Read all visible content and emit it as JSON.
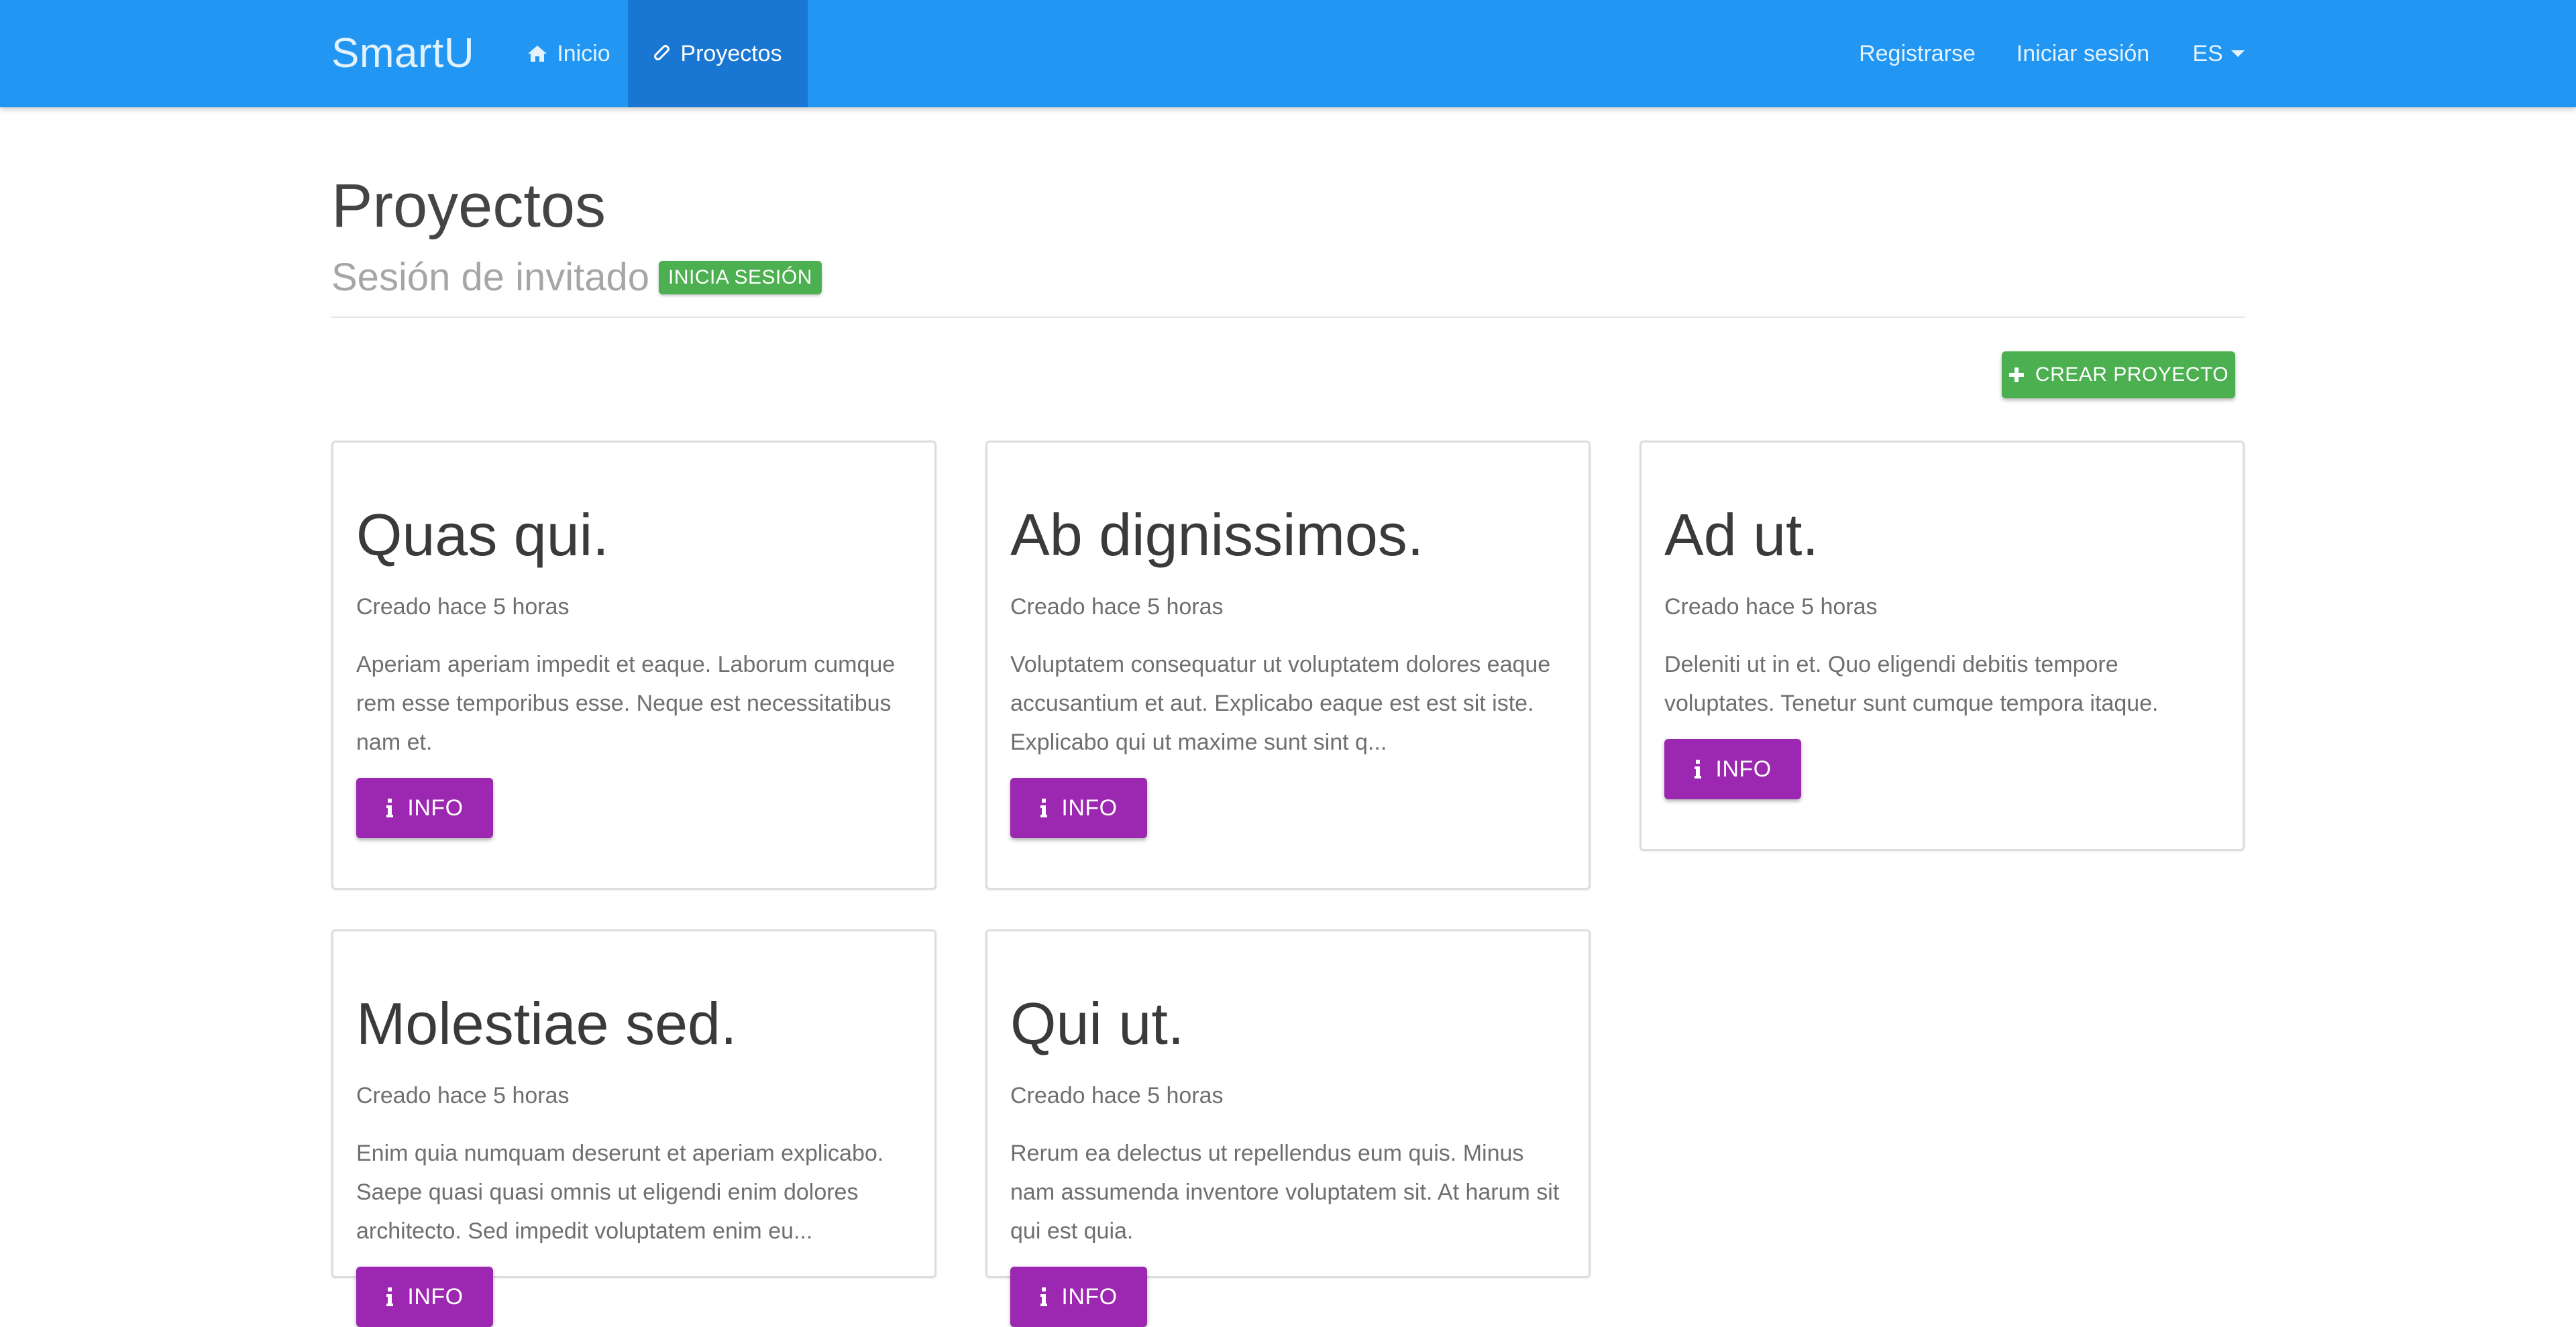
{
  "navbar": {
    "brand": "SmartU",
    "inicio_label": "Inicio",
    "proyectos_label": "Proyectos",
    "registrarse_label": "Registrarse",
    "iniciar_sesion_label": "Iniciar sesión",
    "language_label": "ES"
  },
  "header": {
    "title": "Proyectos",
    "subtitle": "Sesión de invitado",
    "login_badge": "INICIA SESIÓN"
  },
  "toolbar": {
    "create_label": "CREAR PROYECTO"
  },
  "projects": [
    {
      "title": "Quas qui.",
      "created": "Creado hace 5 horas",
      "description": "Aperiam aperiam impedit et eaque. Laborum cumque rem esse temporibus esse. Neque est necessitatibus nam et.",
      "button": "INFO"
    },
    {
      "title": "Ab dignissimos.",
      "created": "Creado hace 5 horas",
      "description": "Voluptatem consequatur ut voluptatem dolores eaque accusantium et aut. Explicabo eaque est est sit iste. Explicabo qui ut maxime sunt sint q...",
      "button": "INFO"
    },
    {
      "title": "Ad ut.",
      "created": "Creado hace 5 horas",
      "description": "Deleniti ut in et. Quo eligendi debitis tempore voluptates. Tenetur sunt cumque tempora itaque.",
      "button": "INFO"
    },
    {
      "title": "Molestiae sed.",
      "created": "Creado hace 5 horas",
      "description": "Enim quia numquam deserunt et aperiam explicabo. Saepe quasi quasi omnis ut eligendi enim dolores architecto. Sed impedit voluptatem enim eu...",
      "button": "INFO"
    },
    {
      "title": "Qui ut.",
      "created": "Creado hace 5 horas",
      "description": "Rerum ea delectus ut repellendus eum quis. Minus nam assumenda inventore voluptatem sit. At harum sit qui est quia.",
      "button": "INFO"
    }
  ],
  "colors": {
    "navbar": "#2196f3",
    "navbar_active": "#1976d2",
    "success": "#4caf50",
    "info_button": "#9c27b0"
  },
  "icons": {
    "inicio": "home-icon",
    "proyectos": "paperclip-icon",
    "create": "plus-icon",
    "info": "info-icon",
    "language": "caret-down-icon"
  }
}
